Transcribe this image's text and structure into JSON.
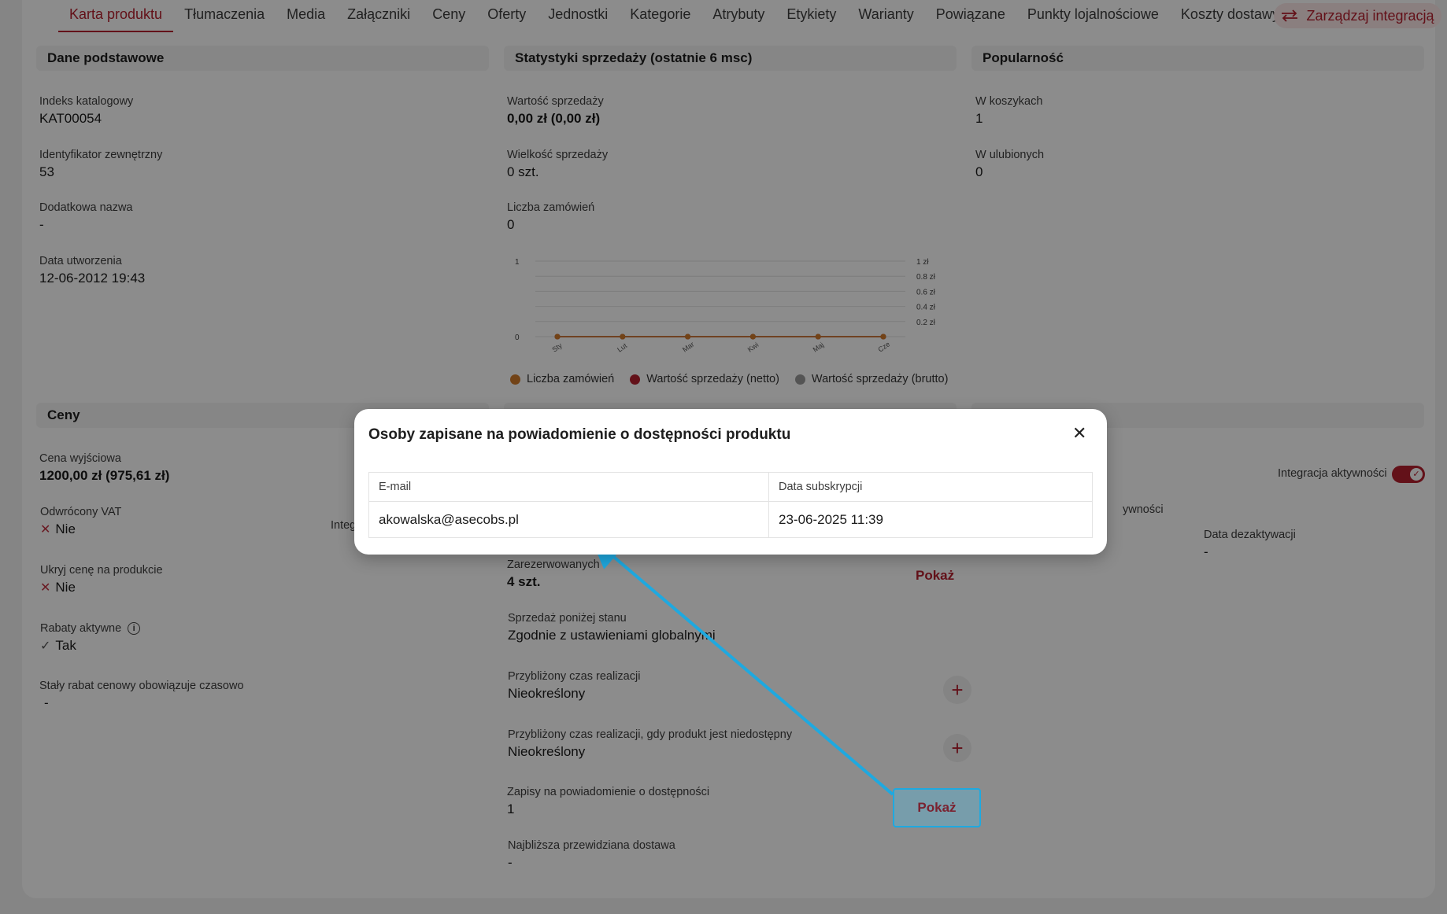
{
  "tabs": [
    "Karta produktu",
    "Tłumaczenia",
    "Media",
    "Załączniki",
    "Ceny",
    "Oferty",
    "Jednostki",
    "Kategorie",
    "Atrybuty",
    "Etykiety",
    "Warianty",
    "Powiązane",
    "Punkty lojalnościowe",
    "Koszty dostawy"
  ],
  "integration_button": "Zarządzaj integracją",
  "basic": {
    "header": "Dane podstawowe",
    "fields": [
      {
        "label": "Indeks katalogowy",
        "value": "KAT00054"
      },
      {
        "label": "Identyfikator zewnętrzny",
        "value": "53"
      },
      {
        "label": "Dodatkowa nazwa",
        "value": "-"
      },
      {
        "label": "Data utworzenia",
        "value": "12-06-2012 19:43"
      }
    ]
  },
  "sales": {
    "header": "Statystyki sprzedaży (ostatnie 6 msc)",
    "fields": [
      {
        "label": "Wartość sprzedaży",
        "value": "0,00 zł (0,00 zł)"
      },
      {
        "label": "Wielkość sprzedaży",
        "value": "0 szt."
      },
      {
        "label": "Liczba zamówień",
        "value": "0"
      }
    ]
  },
  "chart_data": {
    "type": "line",
    "categories": [
      "Sty",
      "Lut",
      "Mar",
      "Kwi",
      "Maj",
      "Cze"
    ],
    "series": [
      {
        "name": "Liczba zamówień",
        "values": [
          0,
          0,
          0,
          0,
          0,
          0
        ],
        "color": "#d07a2a"
      },
      {
        "name": "Wartość sprzedaży (netto)",
        "values": [
          0,
          0,
          0,
          0,
          0,
          0
        ],
        "color": "#b5202e"
      },
      {
        "name": "Wartość sprzedaży (brutto)",
        "values": [
          0,
          0,
          0,
          0,
          0,
          0
        ],
        "color": "#9a9a9a"
      }
    ],
    "y_left_ticks": [
      "1",
      "0"
    ],
    "y_right_ticks": [
      "1 zł",
      "0.8 zł",
      "0.6 zł",
      "0.4 zł",
      "0.2 zł"
    ],
    "ylim": [
      0,
      1
    ],
    "grid": true,
    "legend_position": "bottom"
  },
  "popularity": {
    "header": "Popularność",
    "fields": [
      {
        "label": "W koszykach",
        "value": "1"
      },
      {
        "label": "W ulubionych",
        "value": "0"
      }
    ]
  },
  "prices": {
    "header": "Ceny",
    "fields": [
      {
        "label": "Cena wyjściowa",
        "value": "1200,00 zł (975,61 zł)"
      },
      {
        "label": "Odwrócony VAT",
        "value": "Nie"
      },
      {
        "label": "Ukryj cenę na produkcie",
        "value": "Nie"
      },
      {
        "label": "Rabaty aktywne",
        "value": "Tak"
      },
      {
        "label": "Stały rabat cenowy obowiązuje czasowo",
        "value": "-"
      }
    ],
    "partial_label": "Integ"
  },
  "stock": {
    "fields": [
      {
        "label": "Zarezerwowanych",
        "value": "4 szt."
      },
      {
        "label": "Sprzedaż poniżej stanu",
        "value": "Zgodnie z ustawieniami globalnymi"
      },
      {
        "label": "Przybliżony czas realizacji",
        "value": "Nieokreślony"
      },
      {
        "label": "Przybliżony czas realizacji, gdy produkt jest niedostępny",
        "value": "Nieokreślony"
      },
      {
        "label": "Zapisy na powiadomienie o dostępności",
        "value": "1"
      },
      {
        "label": "Najbliższa przewidziana dostawa",
        "value": "-"
      }
    ],
    "show_label": "Pokaż"
  },
  "activity": {
    "toggle_label": "Integracja aktywności",
    "partial_label": "ywności",
    "deactivation_label": "Data dezaktywacji",
    "deactivation_value": "-"
  },
  "modal": {
    "title": "Osoby zapisane na powiadomienie o dostępności produktu",
    "columns": [
      "E-mail",
      "Data subskrypcji"
    ],
    "rows": [
      [
        "akowalska@asecobs.pl",
        "23-06-2025 11:39"
      ]
    ]
  }
}
